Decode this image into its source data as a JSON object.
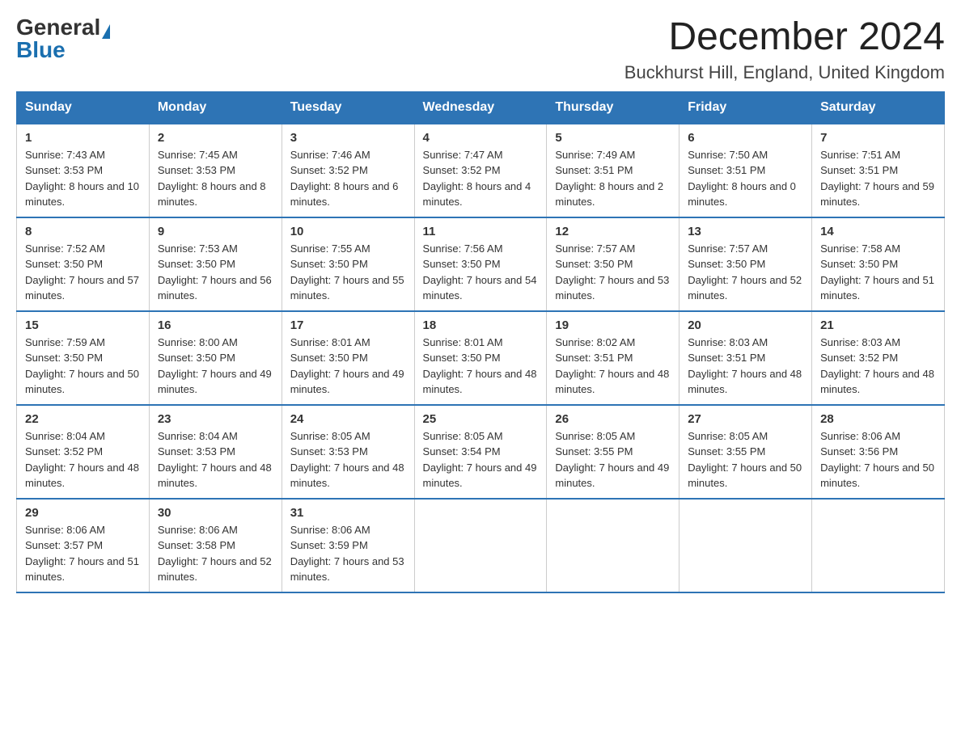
{
  "logo": {
    "general": "General",
    "blue": "Blue"
  },
  "title": {
    "month_year": "December 2024",
    "location": "Buckhurst Hill, England, United Kingdom"
  },
  "days_of_week": [
    "Sunday",
    "Monday",
    "Tuesday",
    "Wednesday",
    "Thursday",
    "Friday",
    "Saturday"
  ],
  "weeks": [
    [
      {
        "day": "1",
        "sunrise": "7:43 AM",
        "sunset": "3:53 PM",
        "daylight": "8 hours and 10 minutes."
      },
      {
        "day": "2",
        "sunrise": "7:45 AM",
        "sunset": "3:53 PM",
        "daylight": "8 hours and 8 minutes."
      },
      {
        "day": "3",
        "sunrise": "7:46 AM",
        "sunset": "3:52 PM",
        "daylight": "8 hours and 6 minutes."
      },
      {
        "day": "4",
        "sunrise": "7:47 AM",
        "sunset": "3:52 PM",
        "daylight": "8 hours and 4 minutes."
      },
      {
        "day": "5",
        "sunrise": "7:49 AM",
        "sunset": "3:51 PM",
        "daylight": "8 hours and 2 minutes."
      },
      {
        "day": "6",
        "sunrise": "7:50 AM",
        "sunset": "3:51 PM",
        "daylight": "8 hours and 0 minutes."
      },
      {
        "day": "7",
        "sunrise": "7:51 AM",
        "sunset": "3:51 PM",
        "daylight": "7 hours and 59 minutes."
      }
    ],
    [
      {
        "day": "8",
        "sunrise": "7:52 AM",
        "sunset": "3:50 PM",
        "daylight": "7 hours and 57 minutes."
      },
      {
        "day": "9",
        "sunrise": "7:53 AM",
        "sunset": "3:50 PM",
        "daylight": "7 hours and 56 minutes."
      },
      {
        "day": "10",
        "sunrise": "7:55 AM",
        "sunset": "3:50 PM",
        "daylight": "7 hours and 55 minutes."
      },
      {
        "day": "11",
        "sunrise": "7:56 AM",
        "sunset": "3:50 PM",
        "daylight": "7 hours and 54 minutes."
      },
      {
        "day": "12",
        "sunrise": "7:57 AM",
        "sunset": "3:50 PM",
        "daylight": "7 hours and 53 minutes."
      },
      {
        "day": "13",
        "sunrise": "7:57 AM",
        "sunset": "3:50 PM",
        "daylight": "7 hours and 52 minutes."
      },
      {
        "day": "14",
        "sunrise": "7:58 AM",
        "sunset": "3:50 PM",
        "daylight": "7 hours and 51 minutes."
      }
    ],
    [
      {
        "day": "15",
        "sunrise": "7:59 AM",
        "sunset": "3:50 PM",
        "daylight": "7 hours and 50 minutes."
      },
      {
        "day": "16",
        "sunrise": "8:00 AM",
        "sunset": "3:50 PM",
        "daylight": "7 hours and 49 minutes."
      },
      {
        "day": "17",
        "sunrise": "8:01 AM",
        "sunset": "3:50 PM",
        "daylight": "7 hours and 49 minutes."
      },
      {
        "day": "18",
        "sunrise": "8:01 AM",
        "sunset": "3:50 PM",
        "daylight": "7 hours and 48 minutes."
      },
      {
        "day": "19",
        "sunrise": "8:02 AM",
        "sunset": "3:51 PM",
        "daylight": "7 hours and 48 minutes."
      },
      {
        "day": "20",
        "sunrise": "8:03 AM",
        "sunset": "3:51 PM",
        "daylight": "7 hours and 48 minutes."
      },
      {
        "day": "21",
        "sunrise": "8:03 AM",
        "sunset": "3:52 PM",
        "daylight": "7 hours and 48 minutes."
      }
    ],
    [
      {
        "day": "22",
        "sunrise": "8:04 AM",
        "sunset": "3:52 PM",
        "daylight": "7 hours and 48 minutes."
      },
      {
        "day": "23",
        "sunrise": "8:04 AM",
        "sunset": "3:53 PM",
        "daylight": "7 hours and 48 minutes."
      },
      {
        "day": "24",
        "sunrise": "8:05 AM",
        "sunset": "3:53 PM",
        "daylight": "7 hours and 48 minutes."
      },
      {
        "day": "25",
        "sunrise": "8:05 AM",
        "sunset": "3:54 PM",
        "daylight": "7 hours and 49 minutes."
      },
      {
        "day": "26",
        "sunrise": "8:05 AM",
        "sunset": "3:55 PM",
        "daylight": "7 hours and 49 minutes."
      },
      {
        "day": "27",
        "sunrise": "8:05 AM",
        "sunset": "3:55 PM",
        "daylight": "7 hours and 50 minutes."
      },
      {
        "day": "28",
        "sunrise": "8:06 AM",
        "sunset": "3:56 PM",
        "daylight": "7 hours and 50 minutes."
      }
    ],
    [
      {
        "day": "29",
        "sunrise": "8:06 AM",
        "sunset": "3:57 PM",
        "daylight": "7 hours and 51 minutes."
      },
      {
        "day": "30",
        "sunrise": "8:06 AM",
        "sunset": "3:58 PM",
        "daylight": "7 hours and 52 minutes."
      },
      {
        "day": "31",
        "sunrise": "8:06 AM",
        "sunset": "3:59 PM",
        "daylight": "7 hours and 53 minutes."
      },
      null,
      null,
      null,
      null
    ]
  ]
}
